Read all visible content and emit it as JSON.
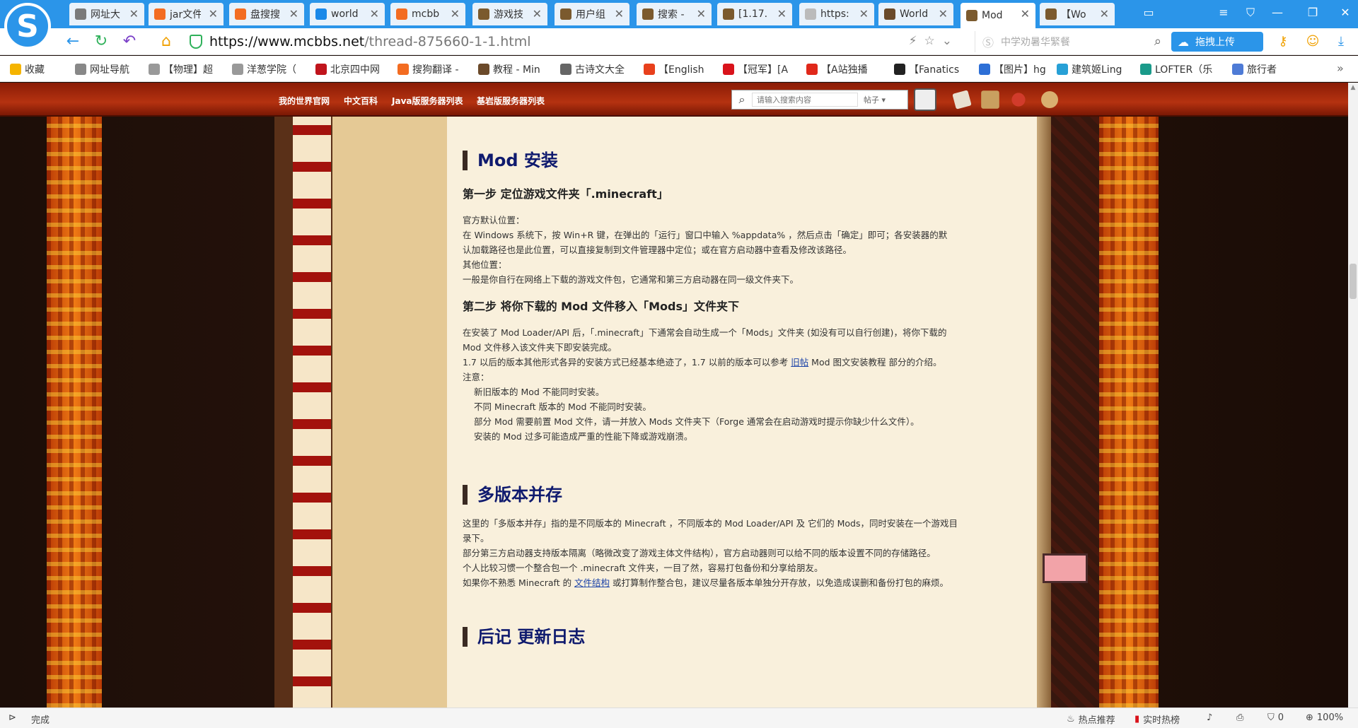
{
  "tabs": [
    {
      "label": "网址大",
      "color": "#7a7a7a"
    },
    {
      "label": "jar文件",
      "color": "#f36c21"
    },
    {
      "label": "盘搜搜",
      "color": "#f36c21"
    },
    {
      "label": "world",
      "color": "#1a88e8"
    },
    {
      "label": "mcbb",
      "color": "#f36c21"
    },
    {
      "label": "游戏技",
      "color": "#7b5a2e"
    },
    {
      "label": "用户组",
      "color": "#7b5a2e"
    },
    {
      "label": "搜索 -",
      "color": "#7b5a2e"
    },
    {
      "label": "[1.17.",
      "color": "#7b5a2e"
    },
    {
      "label": "https:",
      "color": "#bbbbbb"
    },
    {
      "label": "World",
      "color": "#6a4a2a"
    },
    {
      "label": "Mod",
      "color": "#7b5a2e"
    },
    {
      "label": "【Wo",
      "color": "#7b5a2e"
    }
  ],
  "address": {
    "url_main": "https://www.mcbbs.net",
    "url_rest": "/thread-875660-1-1.html",
    "search_placeholder": "中学劝暑华緊餐",
    "upload_label": "拖拽上传"
  },
  "bookmarks": [
    {
      "label": "收藏",
      "color": "#f5b400"
    },
    {
      "label": "网址导航",
      "color": "#888888"
    },
    {
      "label": "【物理】超",
      "color": "#999999"
    },
    {
      "label": "洋葱学院（",
      "color": "#999999"
    },
    {
      "label": "北京四中网",
      "color": "#c0141c"
    },
    {
      "label": "搜狗翻译 -",
      "color": "#f36c21"
    },
    {
      "label": "教程 - Min",
      "color": "#6b4a2a"
    },
    {
      "label": "古诗文大全",
      "color": "#666666"
    },
    {
      "label": "【English",
      "color": "#e8401c"
    },
    {
      "label": "【冠军】[A",
      "color": "#d9131b"
    },
    {
      "label": "【A站独播",
      "color": "#e0281a"
    },
    {
      "label": "【Fanatics",
      "color": "#222222"
    },
    {
      "label": "【图片】hg",
      "color": "#2d6fd6"
    },
    {
      "label": "建筑姬Ling",
      "color": "#27a0d6"
    },
    {
      "label": "LOFTER（乐",
      "color": "#1a9a8a"
    },
    {
      "label": "旅行者",
      "color": "#4e7bd6"
    }
  ],
  "site_nav": {
    "links": [
      "我的世界官网",
      "中文百科",
      "Java版服务器列表",
      "基岩版服务器列表"
    ],
    "search_placeholder": "请输入搜索内容",
    "search_type": "帖子"
  },
  "article": {
    "s1_title": "Mod 安装",
    "step1_title": "第一步 定位游戏文件夹「.minecraft」",
    "step1_lines": [
      "官方默认位置：",
      "在 Windows 系统下，按 Win+R 键，在弹出的「运行」窗口中输入 %appdata% ，然后点击「确定」即可；各安装器的默",
      "认加载路径也是此位置，可以直接复制到文件管理器中定位；或在官方启动器中查看及修改该路径。",
      "其他位置：",
      "一般是你自行在网络上下载的游戏文件包，它通常和第三方启动器在同一级文件夹下。"
    ],
    "step2_title": "第二步 将你下载的 Mod 文件移入「Mods」文件夹下",
    "step2_lines": [
      "在安装了 Mod Loader/API 后，「.minecraft」下通常会自动生成一个「Mods」文件夹 (如没有可以自行创建)，将你下载的",
      "Mod 文件移入该文件夹下即安装完成。"
    ],
    "step2_ref_before": "1.7 以后的版本其他形式各异的安装方式已经基本绝迹了，1.7 以前的版本可以参考 ",
    "step2_ref_link": "旧帖",
    "step2_ref_after": " Mod 图文安装教程 部分的介绍。",
    "note_label": "注意：",
    "notes": [
      "新旧版本的 Mod 不能同时安装。",
      "不同 Minecraft 版本的 Mod 不能同时安装。",
      "部分 Mod 需要前置 Mod 文件，请一并放入 Mods 文件夹下（Forge 通常会在启动游戏时提示你缺少什么文件）。",
      "安装的 Mod 过多可能造成严重的性能下降或游戏崩溃。"
    ],
    "s2_title": "多版本并存",
    "s2_lines": [
      "这里的「多版本并存」指的是不同版本的 Minecraft ，不同版本的 Mod Loader/API 及 它们的 Mods，同时安装在一个游戏目",
      "录下。",
      "部分第三方启动器支持版本隔离（略微改变了游戏主体文件结构），官方启动器则可以给不同的版本设置不同的存储路径。",
      "个人比较习惯一个整合包一个 .minecraft 文件夹，一目了然，容易打包备份和分享给朋友。"
    ],
    "s2_last_before": "如果你不熟悉 Minecraft 的 ",
    "s2_last_link": "文件结构",
    "s2_last_after": " 或打算制作整合包，建议尽量各版本单独分开存放，以免造成误删和备份打包的麻烦。",
    "s3_title": "后记 更新日志"
  },
  "status": {
    "done": "完成",
    "hot_recommend": "热点推荐",
    "realtime_hot": "实时热榜",
    "blocked_count": "0",
    "zoom": "100%"
  },
  "colors": {
    "accent": "#2b95e9",
    "nav_bar": "#b53210",
    "article_bg": "#f9f0dc",
    "heading": "#0f1a6e"
  }
}
